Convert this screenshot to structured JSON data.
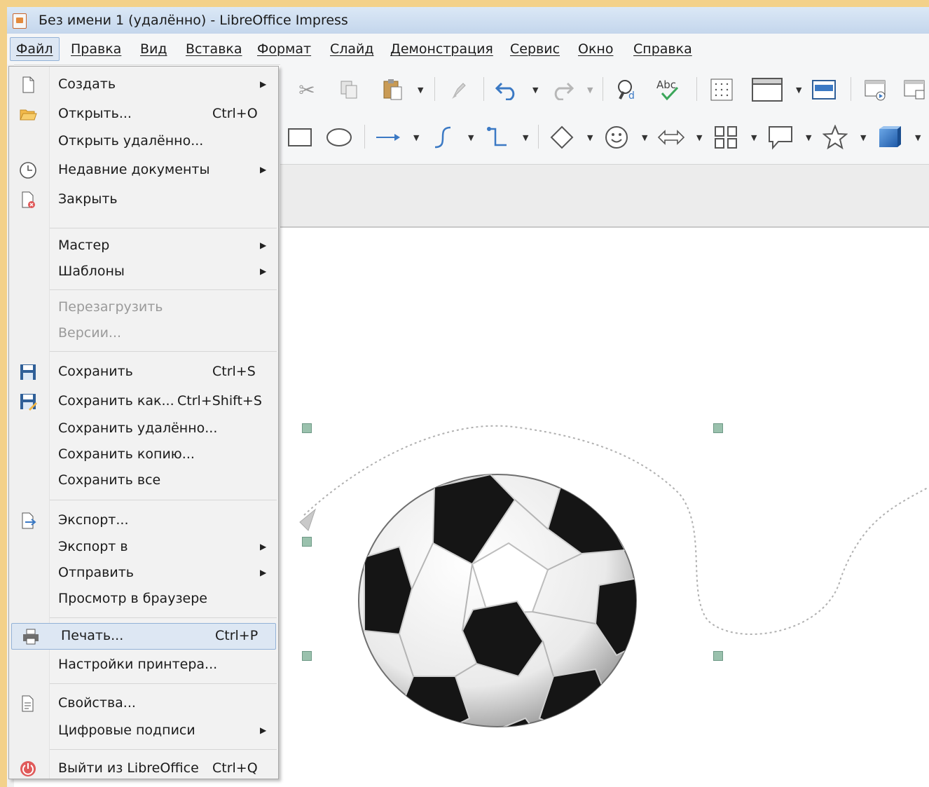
{
  "window": {
    "title": "Без имени 1 (удалённо) - LibreOffice Impress"
  },
  "menubar": [
    "Файл",
    "Правка",
    "Вид",
    "Вставка",
    "Формат",
    "Слайд",
    "Демонстрация",
    "Сервис",
    "Окно",
    "Справка"
  ],
  "file_menu": {
    "create": "Создать",
    "open": "Открыть...",
    "open_shortcut": "Ctrl+O",
    "open_remote": "Открыть удалённо...",
    "recent": "Недавние документы",
    "close": "Закрыть",
    "wizard": "Мастер",
    "templates": "Шаблоны",
    "reload": "Перезагрузить",
    "versions": "Версии...",
    "save": "Сохранить",
    "save_shortcut": "Ctrl+S",
    "save_as": "Сохранить как...",
    "save_as_shortcut": "Ctrl+Shift+S",
    "save_remote": "Сохранить удалённо...",
    "save_copy": "Сохранить копию...",
    "save_all": "Сохранить все",
    "export": "Экспорт...",
    "export_as": "Экспорт в",
    "send": "Отправить",
    "preview_browser": "Просмотр в браузере",
    "print": "Печать...",
    "print_shortcut": "Ctrl+P",
    "printer_settings": "Настройки принтера...",
    "properties": "Свойства...",
    "signatures": "Цифровые подписи",
    "exit": "Выйти из LibreOffice",
    "exit_shortcut": "Ctrl+Q"
  },
  "icons": {
    "submenu": "submenu-arrow-icon",
    "toolbar": [
      "cut-icon",
      "copy-icon",
      "paste-icon",
      "clone-format-icon",
      "undo-icon",
      "redo-icon",
      "find-replace-icon",
      "spelling-icon",
      "grid-icon",
      "slide-layout-icon",
      "master-slide-icon",
      "slideshow-icon",
      "presenter-icon",
      "rectangle-icon",
      "ellipse-icon",
      "line-arrow-icon",
      "curve-icon",
      "connector-icon",
      "basic-shapes-icon",
      "symbol-shapes-icon",
      "block-arrows-icon",
      "flowchart-icon",
      "callout-icon",
      "stars-icon",
      "3d-objects-icon"
    ]
  },
  "colors": {
    "accent_highlight": "#dde7f3",
    "selection_handle": "#9ac1ad",
    "title_bar": "#c4d6ec",
    "slide_background": "#f3d18a"
  }
}
